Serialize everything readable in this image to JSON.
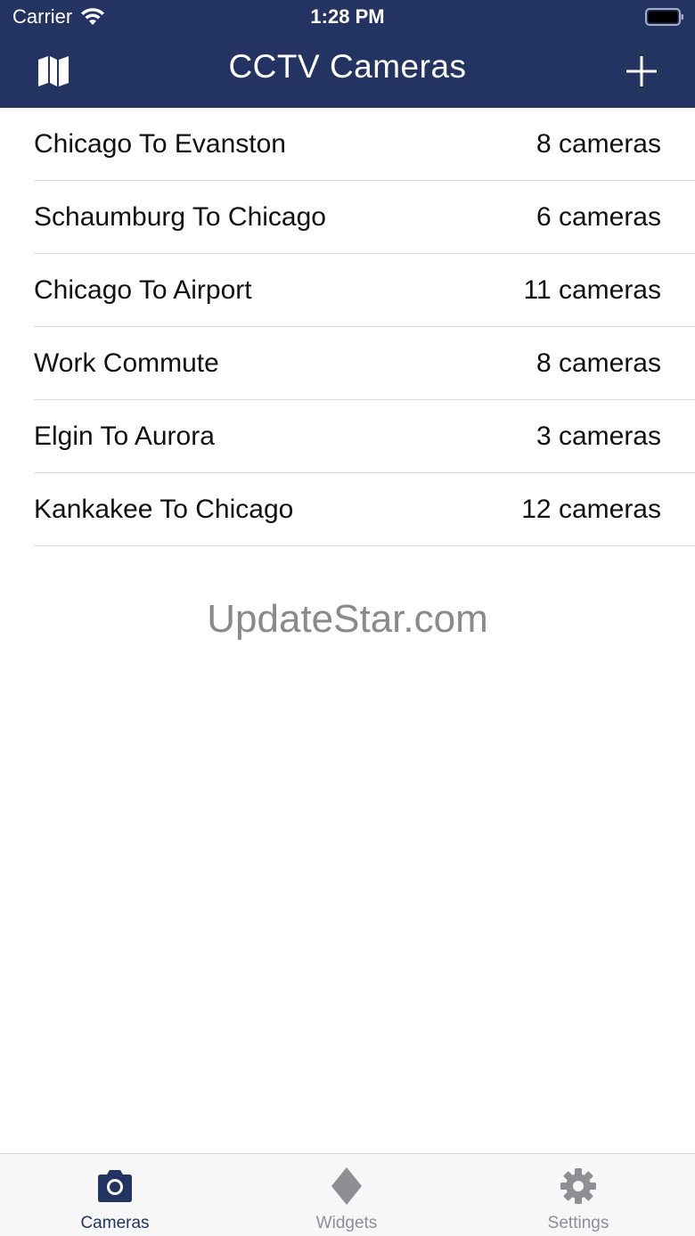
{
  "status": {
    "carrier": "Carrier",
    "time": "1:28 PM"
  },
  "nav": {
    "title": "CCTV Cameras",
    "left_icon": "map-icon",
    "right_icon": "plus-icon"
  },
  "routes": [
    {
      "name": "Chicago To Evanston",
      "count": "8 cameras"
    },
    {
      "name": "Schaumburg To Chicago",
      "count": "6 cameras"
    },
    {
      "name": "Chicago To Airport",
      "count": "11 cameras"
    },
    {
      "name": "Work Commute",
      "count": "8 cameras"
    },
    {
      "name": "Elgin To Aurora",
      "count": "3 cameras"
    },
    {
      "name": "Kankakee To Chicago",
      "count": "12 cameras"
    }
  ],
  "watermark": "UpdateStar.com",
  "tabs": [
    {
      "label": "Cameras",
      "icon": "camera-icon",
      "selected": true
    },
    {
      "label": "Widgets",
      "icon": "diamond-icon",
      "selected": false
    },
    {
      "label": "Settings",
      "icon": "gear-icon",
      "selected": false
    }
  ],
  "colors": {
    "nav_bg": "#233462",
    "tab_active": "#233462",
    "tab_inactive": "#8e8e93"
  }
}
